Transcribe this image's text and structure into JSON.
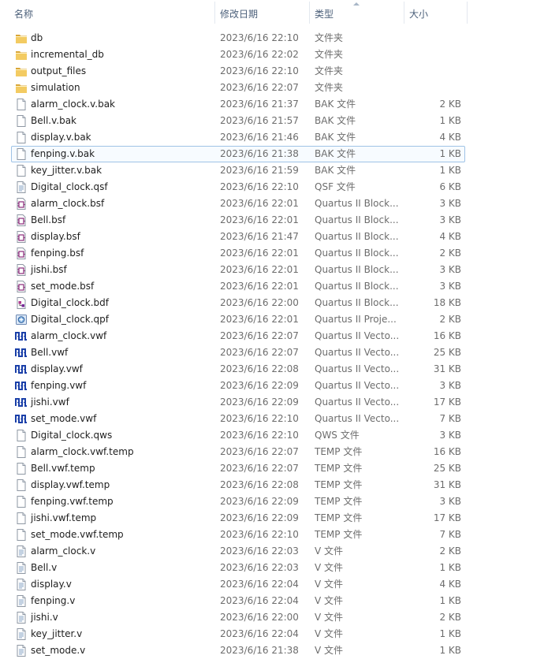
{
  "columns": {
    "name": "名称",
    "date": "修改日期",
    "type": "类型",
    "size": "大小"
  },
  "rows": [
    {
      "name": "db",
      "date": "2023/6/16 22:10",
      "type": "文件夹",
      "size": "",
      "icon": "folder-icon"
    },
    {
      "name": "incremental_db",
      "date": "2023/6/16 22:02",
      "type": "文件夹",
      "size": "",
      "icon": "folder-icon"
    },
    {
      "name": "output_files",
      "date": "2023/6/16 22:10",
      "type": "文件夹",
      "size": "",
      "icon": "folder-icon"
    },
    {
      "name": "simulation",
      "date": "2023/6/16 22:07",
      "type": "文件夹",
      "size": "",
      "icon": "folder-icon"
    },
    {
      "name": "alarm_clock.v.bak",
      "date": "2023/6/16 21:37",
      "type": "BAK 文件",
      "size": "2 KB",
      "icon": "document-icon"
    },
    {
      "name": "Bell.v.bak",
      "date": "2023/6/16 21:57",
      "type": "BAK 文件",
      "size": "1 KB",
      "icon": "document-icon"
    },
    {
      "name": "display.v.bak",
      "date": "2023/6/16 21:46",
      "type": "BAK 文件",
      "size": "4 KB",
      "icon": "document-icon"
    },
    {
      "name": "fenping.v.bak",
      "date": "2023/6/16 21:38",
      "type": "BAK 文件",
      "size": "1 KB",
      "icon": "document-icon",
      "selected": true
    },
    {
      "name": "key_jitter.v.bak",
      "date": "2023/6/16 21:59",
      "type": "BAK 文件",
      "size": "1 KB",
      "icon": "document-icon"
    },
    {
      "name": "Digital_clock.qsf",
      "date": "2023/6/16 22:10",
      "type": "QSF 文件",
      "size": "6 KB",
      "icon": "text-document-icon"
    },
    {
      "name": "alarm_clock.bsf",
      "date": "2023/6/16 22:01",
      "type": "Quartus II Block...",
      "size": "3 KB",
      "icon": "block-symbol-icon"
    },
    {
      "name": "Bell.bsf",
      "date": "2023/6/16 22:01",
      "type": "Quartus II Block...",
      "size": "3 KB",
      "icon": "block-symbol-icon"
    },
    {
      "name": "display.bsf",
      "date": "2023/6/16 21:47",
      "type": "Quartus II Block...",
      "size": "4 KB",
      "icon": "block-symbol-icon"
    },
    {
      "name": "fenping.bsf",
      "date": "2023/6/16 22:01",
      "type": "Quartus II Block...",
      "size": "2 KB",
      "icon": "block-symbol-icon"
    },
    {
      "name": "jishi.bsf",
      "date": "2023/6/16 22:01",
      "type": "Quartus II Block...",
      "size": "3 KB",
      "icon": "block-symbol-icon"
    },
    {
      "name": "set_mode.bsf",
      "date": "2023/6/16 22:01",
      "type": "Quartus II Block...",
      "size": "3 KB",
      "icon": "block-symbol-icon"
    },
    {
      "name": "Digital_clock.bdf",
      "date": "2023/6/16 22:00",
      "type": "Quartus II Block...",
      "size": "18 KB",
      "icon": "block-diagram-icon"
    },
    {
      "name": "Digital_clock.qpf",
      "date": "2023/6/16 22:01",
      "type": "Quartus II Proje...",
      "size": "2 KB",
      "icon": "project-icon"
    },
    {
      "name": "alarm_clock.vwf",
      "date": "2023/6/16 22:07",
      "type": "Quartus II Vecto...",
      "size": "16 KB",
      "icon": "waveform-icon"
    },
    {
      "name": "Bell.vwf",
      "date": "2023/6/16 22:07",
      "type": "Quartus II Vecto...",
      "size": "25 KB",
      "icon": "waveform-icon"
    },
    {
      "name": "display.vwf",
      "date": "2023/6/16 22:08",
      "type": "Quartus II Vecto...",
      "size": "31 KB",
      "icon": "waveform-icon"
    },
    {
      "name": "fenping.vwf",
      "date": "2023/6/16 22:09",
      "type": "Quartus II Vecto...",
      "size": "3 KB",
      "icon": "waveform-icon"
    },
    {
      "name": "jishi.vwf",
      "date": "2023/6/16 22:09",
      "type": "Quartus II Vecto...",
      "size": "17 KB",
      "icon": "waveform-icon"
    },
    {
      "name": "set_mode.vwf",
      "date": "2023/6/16 22:10",
      "type": "Quartus II Vecto...",
      "size": "7 KB",
      "icon": "waveform-icon"
    },
    {
      "name": "Digital_clock.qws",
      "date": "2023/6/16 22:10",
      "type": "QWS 文件",
      "size": "3 KB",
      "icon": "document-icon"
    },
    {
      "name": "alarm_clock.vwf.temp",
      "date": "2023/6/16 22:07",
      "type": "TEMP 文件",
      "size": "16 KB",
      "icon": "document-icon"
    },
    {
      "name": "Bell.vwf.temp",
      "date": "2023/6/16 22:07",
      "type": "TEMP 文件",
      "size": "25 KB",
      "icon": "document-icon"
    },
    {
      "name": "display.vwf.temp",
      "date": "2023/6/16 22:08",
      "type": "TEMP 文件",
      "size": "31 KB",
      "icon": "document-icon"
    },
    {
      "name": "fenping.vwf.temp",
      "date": "2023/6/16 22:09",
      "type": "TEMP 文件",
      "size": "3 KB",
      "icon": "document-icon"
    },
    {
      "name": "jishi.vwf.temp",
      "date": "2023/6/16 22:09",
      "type": "TEMP 文件",
      "size": "17 KB",
      "icon": "document-icon"
    },
    {
      "name": "set_mode.vwf.temp",
      "date": "2023/6/16 22:10",
      "type": "TEMP 文件",
      "size": "7 KB",
      "icon": "document-icon"
    },
    {
      "name": "alarm_clock.v",
      "date": "2023/6/16 22:03",
      "type": "V 文件",
      "size": "2 KB",
      "icon": "text-document-icon"
    },
    {
      "name": "Bell.v",
      "date": "2023/6/16 22:03",
      "type": "V 文件",
      "size": "1 KB",
      "icon": "text-document-icon"
    },
    {
      "name": "display.v",
      "date": "2023/6/16 22:04",
      "type": "V 文件",
      "size": "4 KB",
      "icon": "text-document-icon"
    },
    {
      "name": "fenping.v",
      "date": "2023/6/16 22:04",
      "type": "V 文件",
      "size": "1 KB",
      "icon": "text-document-icon"
    },
    {
      "name": "jishi.v",
      "date": "2023/6/16 22:00",
      "type": "V 文件",
      "size": "2 KB",
      "icon": "text-document-icon"
    },
    {
      "name": "key_jitter.v",
      "date": "2023/6/16 22:04",
      "type": "V 文件",
      "size": "1 KB",
      "icon": "text-document-icon"
    },
    {
      "name": "set_mode.v",
      "date": "2023/6/16 21:38",
      "type": "V 文件",
      "size": "1 KB",
      "icon": "text-document-icon"
    }
  ],
  "colors": {
    "header_text": "#4c607a",
    "selection_border": "#9fc3e6",
    "folder": "#e8b94a",
    "waveform": "#1a3fa8",
    "block_symbol": "#8a2a7a"
  }
}
